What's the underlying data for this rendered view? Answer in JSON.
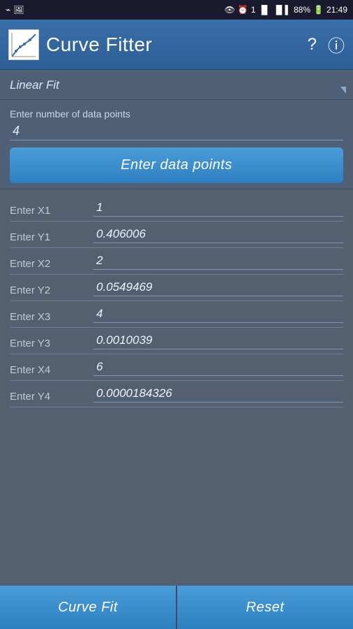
{
  "statusBar": {
    "time": "21:49",
    "battery": "88%",
    "signal": "▲▲▲▲"
  },
  "header": {
    "title": "Curve Fitter",
    "helpLabel": "?",
    "infoLabel": "ⓘ"
  },
  "dropdownSection": {
    "label": "Linear Fit"
  },
  "dataPointsSection": {
    "fieldLabel": "Enter number of data points",
    "fieldValue": "4",
    "enterBtnLabel": "Enter data points"
  },
  "fields": [
    {
      "label": "Enter X1",
      "value": "1"
    },
    {
      "label": "Enter Y1",
      "value": "0.406006"
    },
    {
      "label": "Enter X2",
      "value": "2"
    },
    {
      "label": "Enter Y2",
      "value": "0.0549469"
    },
    {
      "label": "Enter X3",
      "value": "4"
    },
    {
      "label": "Enter Y3",
      "value": "0.0010039"
    },
    {
      "label": "Enter X4",
      "value": "6"
    },
    {
      "label": "Enter Y4",
      "value": "0.0000184326"
    }
  ],
  "bottomBar": {
    "curveFitLabel": "Curve Fit",
    "resetLabel": "Reset"
  }
}
